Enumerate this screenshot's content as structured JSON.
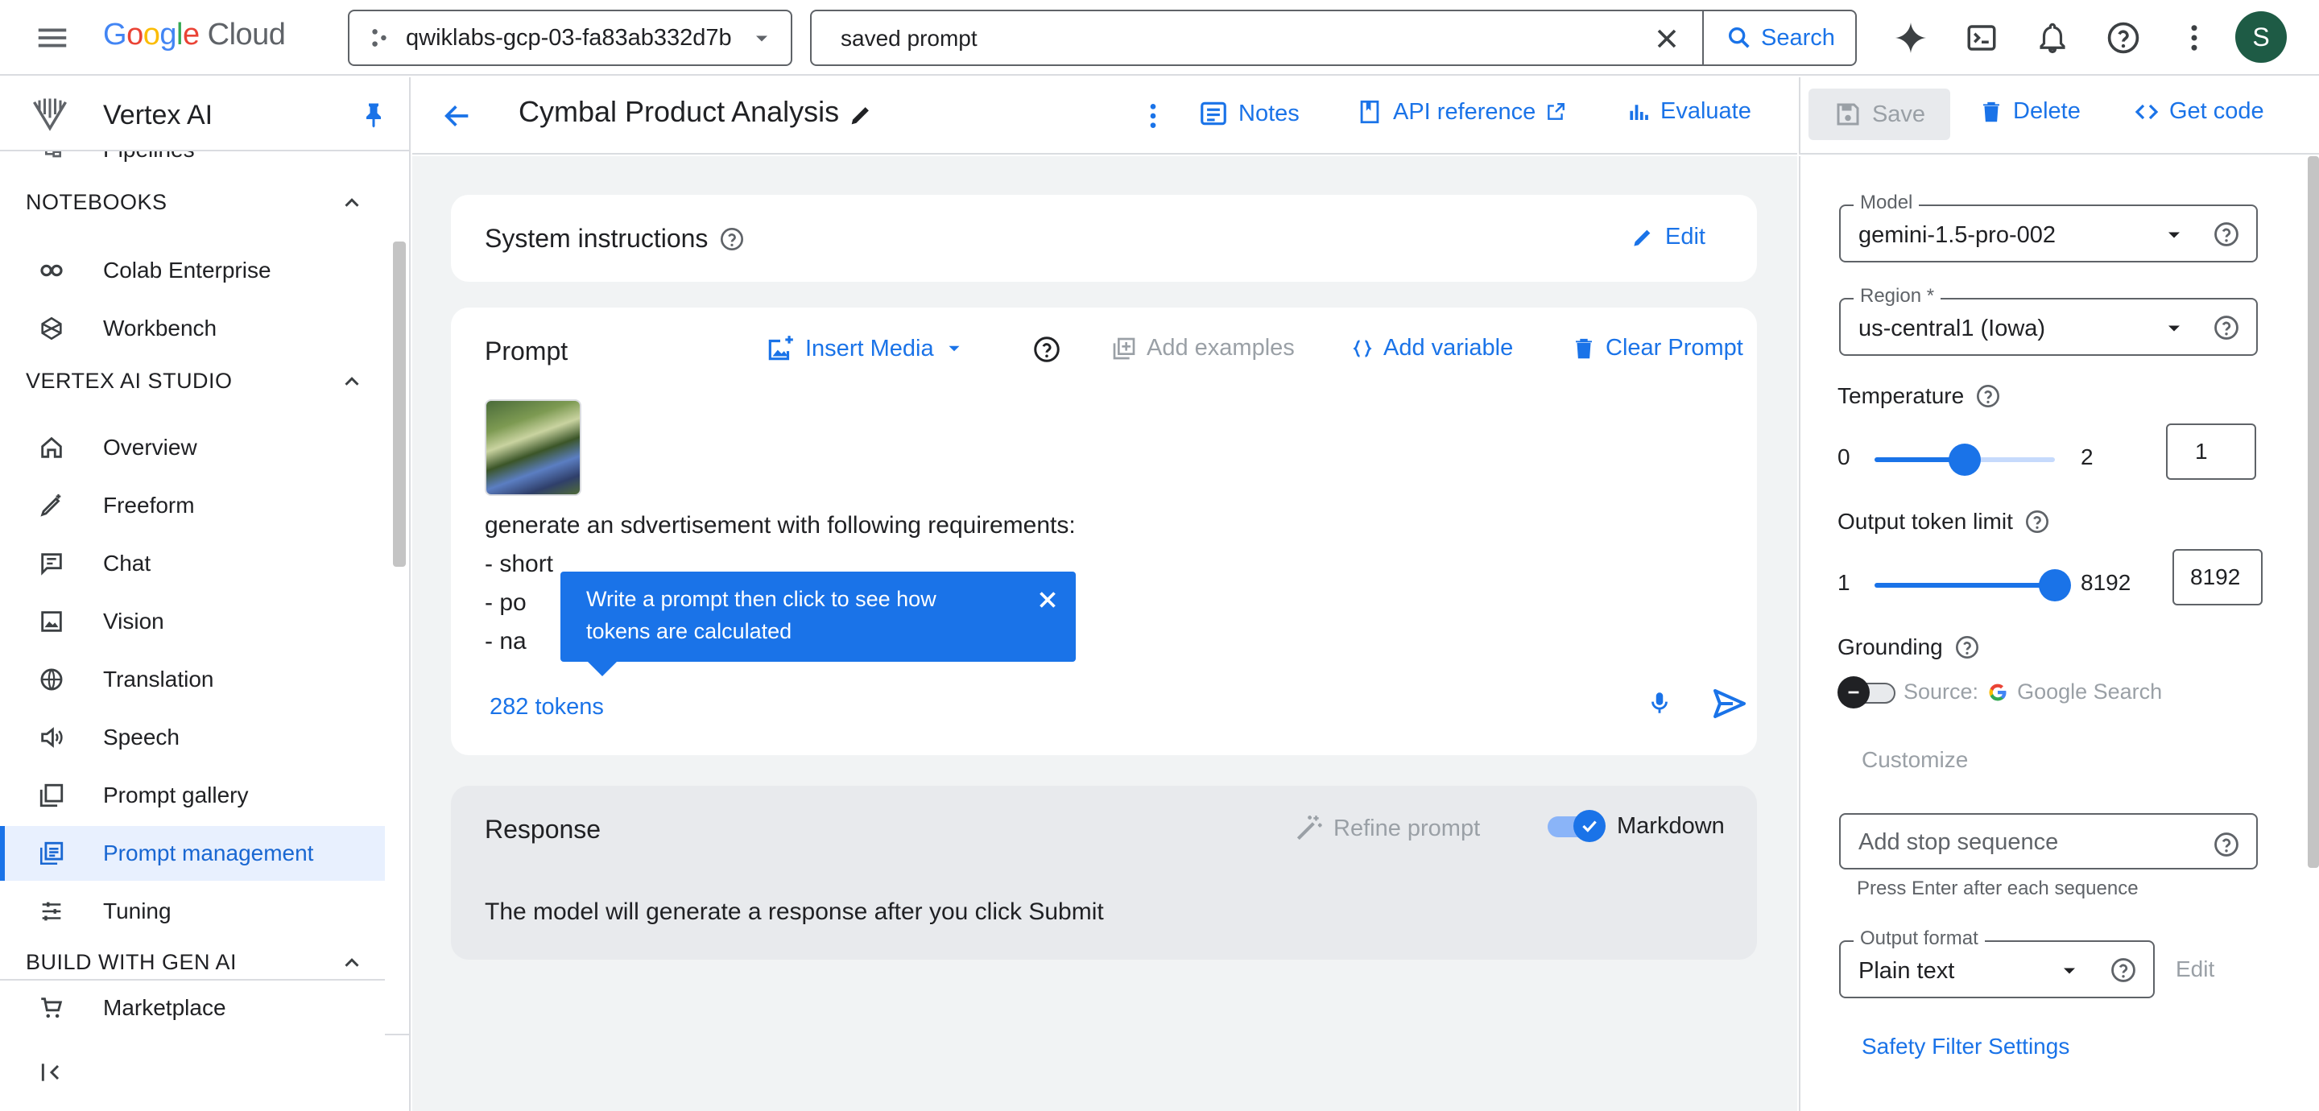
{
  "topbar": {
    "logo_google_g": "G",
    "logo_google_o1": "o",
    "logo_google_o2": "o",
    "logo_google_g2": "g",
    "logo_google_l": "l",
    "logo_google_e": "e",
    "logo_cloud": " Cloud",
    "project": "qwiklabs-gcp-03-fa83ab332d7b",
    "search_value": "saved prompt",
    "search_button": "Search",
    "avatar_letter": "S"
  },
  "sidebar": {
    "title": "Vertex AI",
    "partial_item": "Pipelines",
    "sections": {
      "notebooks": "NOTEBOOKS",
      "studio": "VERTEX AI STUDIO",
      "build": "BUILD WITH GEN AI"
    },
    "items": {
      "colab": "Colab Enterprise",
      "workbench": "Workbench",
      "overview": "Overview",
      "freeform": "Freeform",
      "chat": "Chat",
      "vision": "Vision",
      "translation": "Translation",
      "speech": "Speech",
      "gallery": "Prompt gallery",
      "management": "Prompt management",
      "tuning": "Tuning",
      "marketplace": "Marketplace"
    }
  },
  "header": {
    "title": "Cymbal Product Analysis",
    "notes": "Notes",
    "api_reference": "API reference",
    "evaluate": "Evaluate",
    "save": "Save",
    "delete": "Delete",
    "get_code": "Get code"
  },
  "system": {
    "title": "System instructions",
    "edit": "Edit"
  },
  "prompt": {
    "title": "Prompt",
    "insert_media": "Insert Media",
    "add_examples": "Add examples",
    "add_variable": "Add variable",
    "clear": "Clear Prompt",
    "lines": [
      "generate an sdvertisement with following requirements:",
      "- short",
      "- po",
      "- na"
    ],
    "tooltip": "Write a prompt then click to see how tokens are calculated",
    "tokens": "282 tokens"
  },
  "response": {
    "title": "Response",
    "refine": "Refine prompt",
    "markdown": "Markdown",
    "markdown_on": true,
    "placeholder": "The model will generate a response after you click Submit"
  },
  "settings": {
    "model_label": "Model",
    "model_value": "gemini-1.5-pro-002",
    "region_label": "Region *",
    "region_value": "us-central1 (Iowa)",
    "temperature_label": "Temperature",
    "temperature_min": "0",
    "temperature_max": "2",
    "temperature_value": "1",
    "token_limit_label": "Output token limit",
    "token_min": "1",
    "token_max": "8192",
    "token_value": "8192",
    "grounding_label": "Grounding",
    "grounding_source": "Source:",
    "grounding_provider": "Google Search",
    "grounding_on": false,
    "customize": "Customize",
    "stop_placeholder": "Add stop sequence",
    "stop_hint": "Press Enter after each sequence",
    "output_format_label": "Output format",
    "output_format_value": "Plain text",
    "output_format_edit": "Edit",
    "safety": "Safety Filter Settings"
  },
  "colors": {
    "accent": "#1a73e8",
    "active_bg": "#e8f0fe",
    "avatar": "#1e5b45"
  }
}
